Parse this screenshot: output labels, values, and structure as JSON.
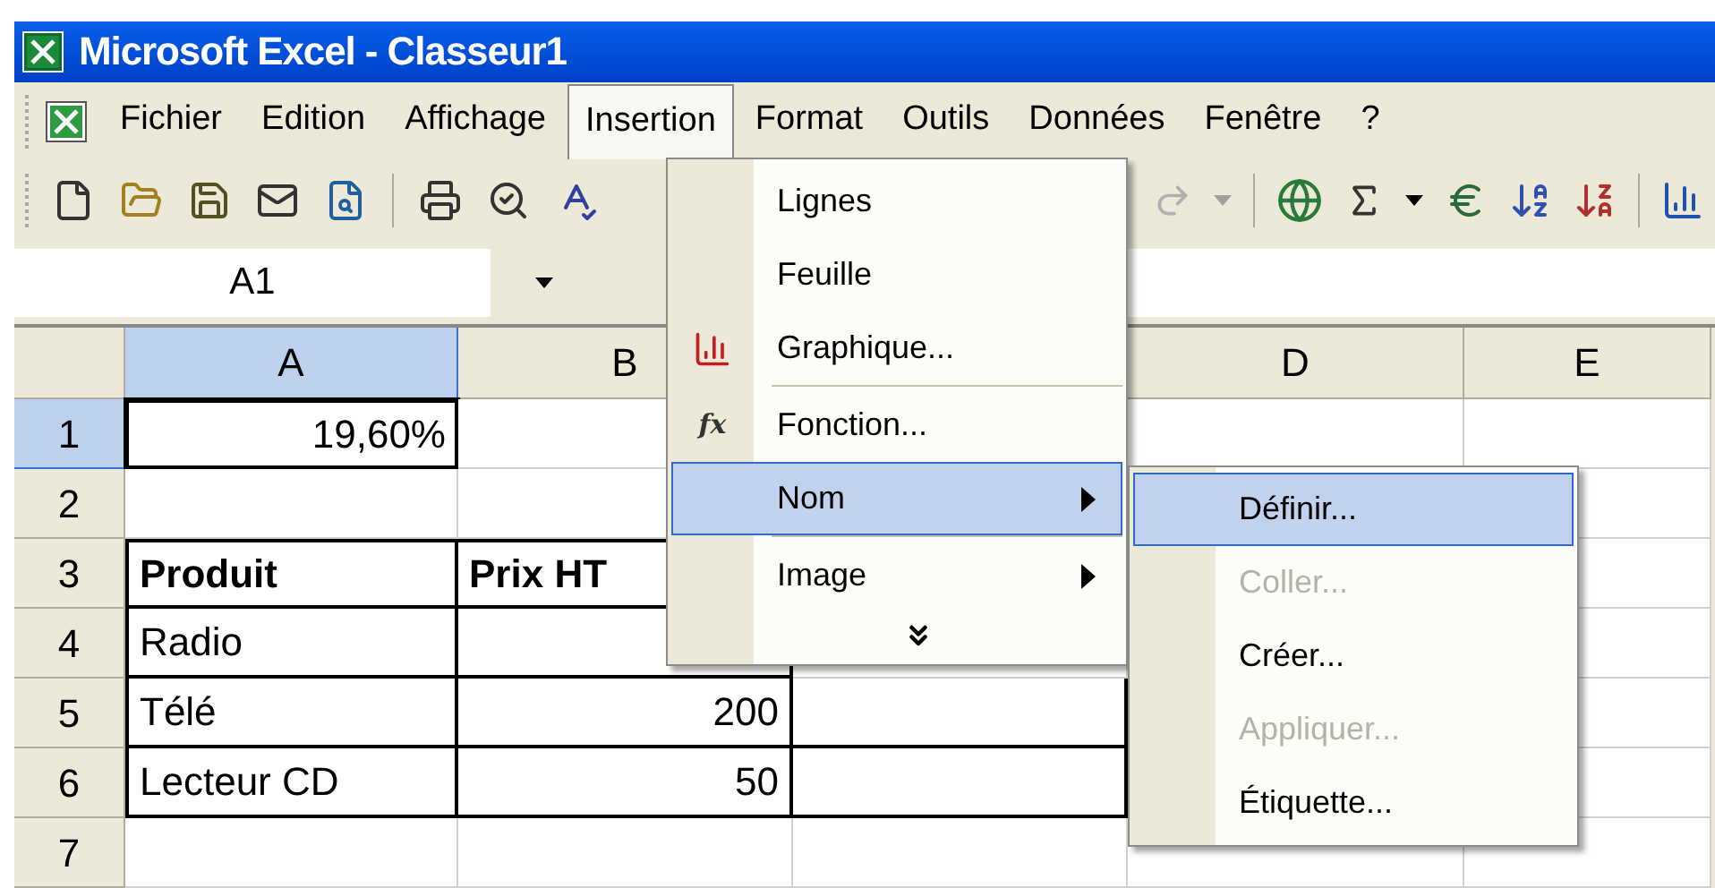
{
  "window": {
    "title": "Microsoft Excel - Classeur1"
  },
  "menubar": [
    {
      "label": "Fichier",
      "selected": false
    },
    {
      "label": "Edition",
      "selected": false
    },
    {
      "label": "Affichage",
      "selected": false
    },
    {
      "label": "Insertion",
      "selected": true
    },
    {
      "label": "Format",
      "selected": false
    },
    {
      "label": "Outils",
      "selected": false
    },
    {
      "label": "Données",
      "selected": false
    },
    {
      "label": "Fenêtre",
      "selected": false
    },
    {
      "label": "?",
      "selected": false
    }
  ],
  "name_box": {
    "value": "A1"
  },
  "columns": [
    {
      "label": "A",
      "selected": true
    },
    {
      "label": "B",
      "selected": false
    },
    {},
    {
      "label": "D",
      "selected": false
    },
    {
      "label": "E",
      "selected": false
    }
  ],
  "rows": [
    {
      "label": "1",
      "selected": true,
      "cells": [
        {
          "text": "19,60%",
          "kind": "number",
          "active": true
        },
        {},
        {},
        {},
        {}
      ]
    },
    {
      "label": "2",
      "selected": false,
      "cells": [
        {},
        {},
        {},
        {},
        {}
      ]
    },
    {
      "label": "3",
      "selected": false,
      "cells": [
        {
          "text": "Produit",
          "kind": "text",
          "bold": true,
          "border": true
        },
        {
          "text": "Prix HT",
          "kind": "text",
          "bold": true,
          "border": true
        },
        {},
        {},
        {}
      ]
    },
    {
      "label": "4",
      "selected": false,
      "cells": [
        {
          "text": "Radio",
          "kind": "text",
          "border": true
        },
        {
          "border": true
        },
        {},
        {},
        {}
      ]
    },
    {
      "label": "5",
      "selected": false,
      "cells": [
        {
          "text": "Télé",
          "kind": "text",
          "border": true
        },
        {
          "text": "200",
          "kind": "number",
          "border": true
        },
        {
          "border": true
        },
        {},
        {}
      ]
    },
    {
      "label": "6",
      "selected": false,
      "cells": [
        {
          "text": "Lecteur CD",
          "kind": "text",
          "border": true
        },
        {
          "text": "50",
          "kind": "number",
          "border": true
        },
        {
          "border": true
        },
        {},
        {}
      ]
    },
    {
      "label": "7",
      "selected": false,
      "cells": [
        {},
        {},
        {},
        {},
        {}
      ]
    }
  ],
  "insertion_menu": [
    {
      "kind": "item",
      "label": "Lignes",
      "selected": false
    },
    {
      "kind": "item",
      "label": "Feuille",
      "selected": false
    },
    {
      "kind": "item",
      "label": "Graphique...",
      "selected": false
    },
    {
      "kind": "separator"
    },
    {
      "kind": "item",
      "label": "Fonction...",
      "glyph": "fx",
      "selected": false
    },
    {
      "kind": "submenu",
      "label": "Nom",
      "selected": true
    },
    {
      "kind": "separator"
    },
    {
      "kind": "submenu",
      "label": "Image",
      "selected": false
    },
    {
      "kind": "expand"
    }
  ],
  "name_submenu": [
    {
      "label": "Définir...",
      "selected": true,
      "disabled": false
    },
    {
      "label": "Coller...",
      "selected": false,
      "disabled": true
    },
    {
      "label": "Créer...",
      "selected": false,
      "disabled": false
    },
    {
      "label": "Appliquer...",
      "selected": false,
      "disabled": true
    },
    {
      "label": "Étiquette...",
      "selected": false,
      "disabled": false
    }
  ]
}
